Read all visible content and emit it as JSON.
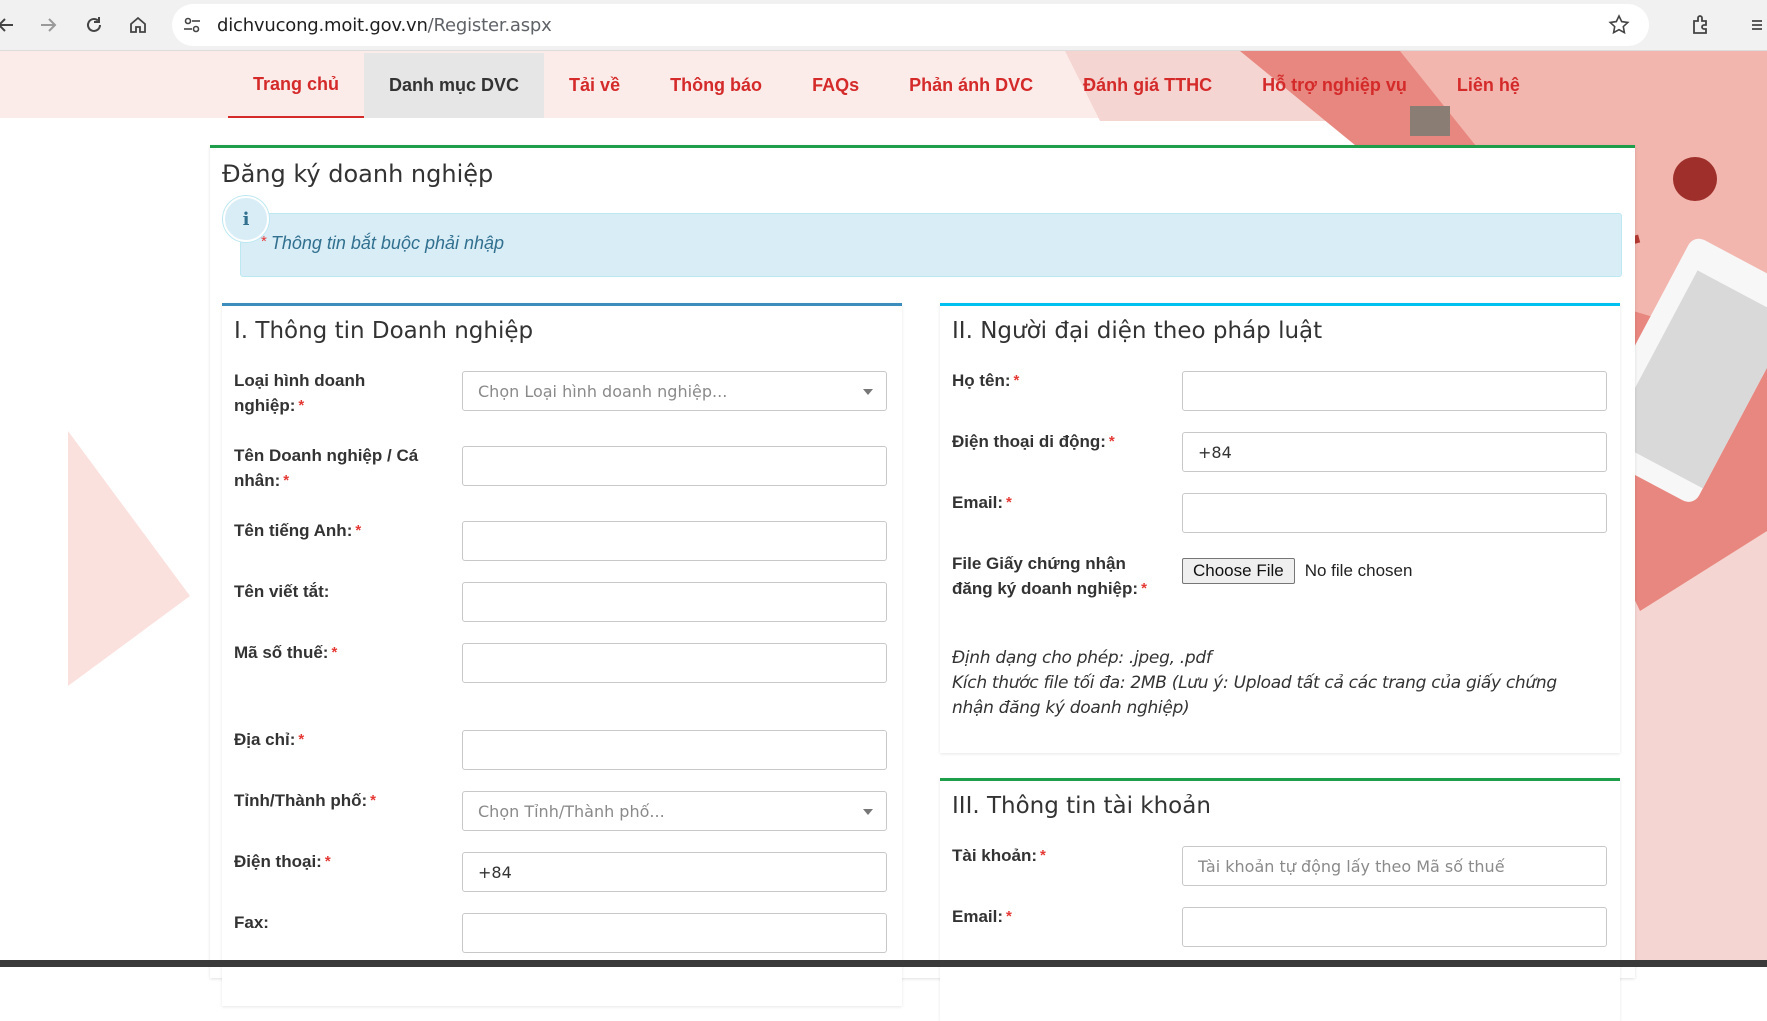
{
  "browser": {
    "url_host": "dichvucong.moit.gov.vn",
    "url_path": "/Register.aspx",
    "icons": [
      "back-icon",
      "forward-icon",
      "reload-icon",
      "home-icon",
      "site-settings-icon",
      "bookmark-star-icon",
      "extensions-icon"
    ]
  },
  "nav": {
    "items": [
      {
        "label": "Trang chủ"
      },
      {
        "label": "Danh mục DVC"
      },
      {
        "label": "Tải về"
      },
      {
        "label": "Thông báo"
      },
      {
        "label": "FAQs"
      },
      {
        "label": "Phản ánh DVC"
      },
      {
        "label": "Đánh giá TTHC"
      },
      {
        "label": "Hỗ trợ nghiệp vụ"
      },
      {
        "label": "Liên hệ"
      }
    ],
    "active_index": 0,
    "hover_index": 1
  },
  "page": {
    "title": "Đăng ký doanh nghiệp",
    "notice": "Thông tin bắt buộc phải nhập",
    "required_mark": "*"
  },
  "section1": {
    "title": "I. Thông tin Doanh nghiệp",
    "fields": {
      "business_type": {
        "label": "Loại hình doanh nghiệp:",
        "placeholder": "Chọn Loại hình doanh nghiệp..."
      },
      "company_name": {
        "label": "Tên Doanh nghiệp / Cá nhân:",
        "value": ""
      },
      "english_name": {
        "label": "Tên tiếng Anh:",
        "value": ""
      },
      "short_name": {
        "label": "Tên viết tắt:",
        "value": ""
      },
      "tax_code": {
        "label": "Mã số thuế:",
        "value": ""
      },
      "address": {
        "label": "Địa chỉ:",
        "value": ""
      },
      "province": {
        "label": "Tỉnh/Thành phố:",
        "placeholder": "Chọn Tỉnh/Thành phố..."
      },
      "phone": {
        "label": "Điện thoại:",
        "value": "+84"
      },
      "fax": {
        "label": "Fax:",
        "value": ""
      }
    }
  },
  "section2": {
    "title": "II. Người đại diện theo pháp luật",
    "fields": {
      "full_name": {
        "label": "Họ tên:",
        "value": ""
      },
      "mobile": {
        "label": "Điện thoại di động:",
        "value": "+84"
      },
      "email": {
        "label": "Email:",
        "value": ""
      },
      "certificate_file": {
        "label": "File Giấy chứng nhận đăng ký doanh nghiệp:",
        "button": "Choose File",
        "status": "No file chosen"
      }
    },
    "hint_formats": "Định dạng cho phép: .jpeg, .pdf",
    "hint_size": "Kích thước file tối đa: 2MB (Lưu ý: Upload tất cả các trang của giấy chứng nhận đăng ký doanh nghiệp)"
  },
  "section3": {
    "title": "III. Thông tin tài khoản",
    "fields": {
      "account": {
        "label": "Tài khoản:",
        "placeholder": "Tài khoản tự động lấy theo Mã số thuế"
      },
      "email": {
        "label": "Email:",
        "value": ""
      }
    }
  },
  "colors": {
    "nav_text": "#d42a2a",
    "panel_border": "#1e9e4a",
    "section1_border": "#3c8dbc",
    "section2_border": "#00c0ef",
    "notice_bg": "#d9edf7",
    "notice_text": "#31708f",
    "required": "#e53935"
  }
}
